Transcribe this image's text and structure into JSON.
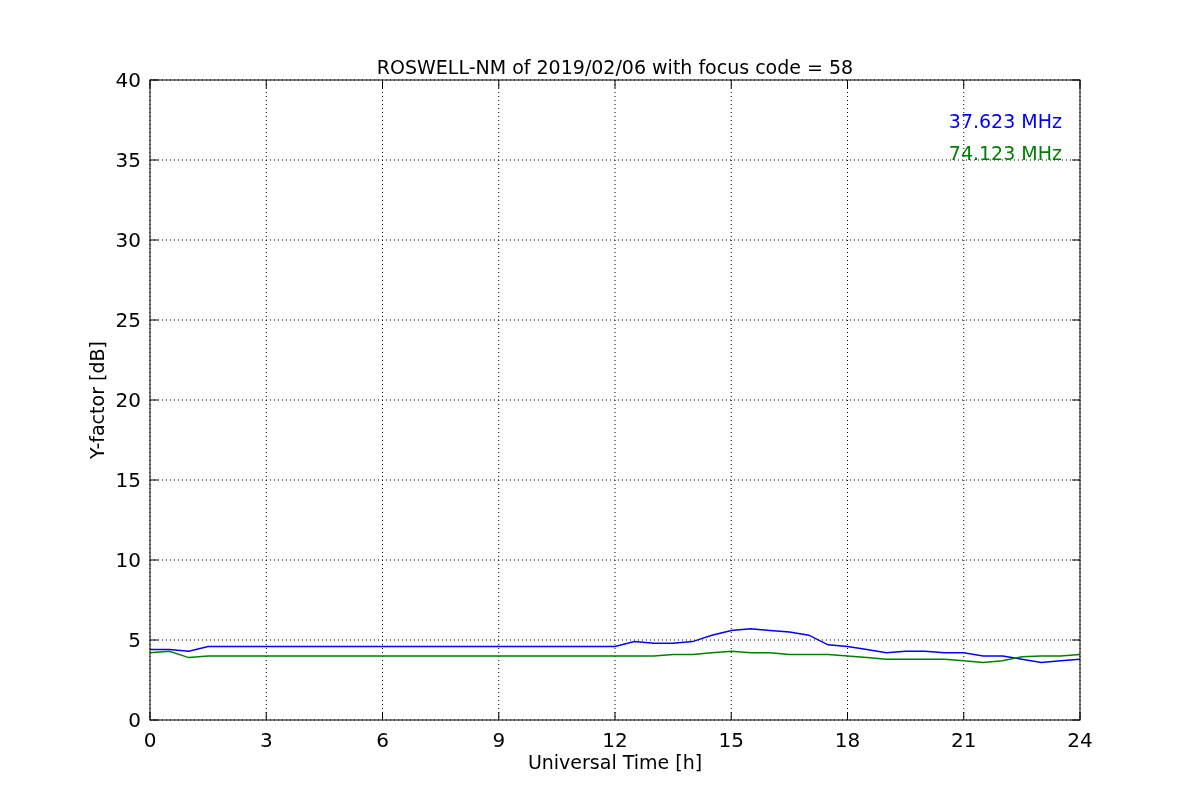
{
  "figure": {
    "chart_data": {
      "type": "line",
      "title": "ROSWELL-NM of 2019/02/06 with focus code = 58",
      "xlabel": "Universal Time [h]",
      "ylabel": "Y-factor [dB]",
      "x": [
        0,
        0.5,
        1,
        1.5,
        2,
        2.5,
        3,
        3.5,
        4,
        4.5,
        5,
        5.5,
        6,
        6.5,
        7,
        7.5,
        8,
        8.5,
        9,
        9.5,
        10,
        10.5,
        11,
        11.5,
        12,
        12.5,
        13,
        13.5,
        14,
        14.5,
        15,
        15.5,
        16,
        16.5,
        17,
        17.5,
        18,
        18.5,
        19,
        19.5,
        20,
        20.5,
        21,
        21.5,
        22,
        22.5,
        23,
        23.5,
        24
      ],
      "series": [
        {
          "name": "37.623 MHz",
          "color": "#0000ff",
          "values": [
            4.4,
            4.4,
            4.3,
            4.6,
            4.6,
            4.6,
            4.6,
            4.6,
            4.6,
            4.6,
            4.6,
            4.6,
            4.6,
            4.6,
            4.6,
            4.6,
            4.6,
            4.6,
            4.6,
            4.6,
            4.6,
            4.6,
            4.6,
            4.6,
            4.6,
            4.9,
            4.8,
            4.8,
            4.9,
            5.3,
            5.6,
            5.7,
            5.6,
            5.5,
            5.3,
            4.7,
            4.6,
            4.4,
            4.2,
            4.3,
            4.3,
            4.2,
            4.2,
            4.0,
            4.0,
            3.8,
            3.6,
            3.7,
            3.8
          ]
        },
        {
          "name": "74.123 MHz",
          "color": "#008000",
          "values": [
            4.2,
            4.3,
            3.9,
            4.0,
            4.0,
            4.0,
            4.0,
            4.0,
            4.0,
            4.0,
            4.0,
            4.0,
            4.0,
            4.0,
            4.0,
            4.0,
            4.0,
            4.0,
            4.0,
            4.0,
            4.0,
            4.0,
            4.0,
            4.0,
            4.0,
            4.0,
            4.0,
            4.1,
            4.1,
            4.2,
            4.3,
            4.2,
            4.2,
            4.1,
            4.1,
            4.1,
            4.0,
            3.9,
            3.8,
            3.8,
            3.8,
            3.8,
            3.7,
            3.6,
            3.7,
            3.95,
            4.0,
            4.0,
            4.1
          ]
        }
      ],
      "grid": true,
      "xlim": [
        0,
        24
      ],
      "ylim": [
        0,
        40
      ],
      "xticks": [
        0,
        3,
        6,
        9,
        12,
        15,
        18,
        21,
        24
      ],
      "yticks": [
        0,
        5,
        10,
        15,
        20,
        25,
        30,
        35,
        40
      ]
    }
  }
}
